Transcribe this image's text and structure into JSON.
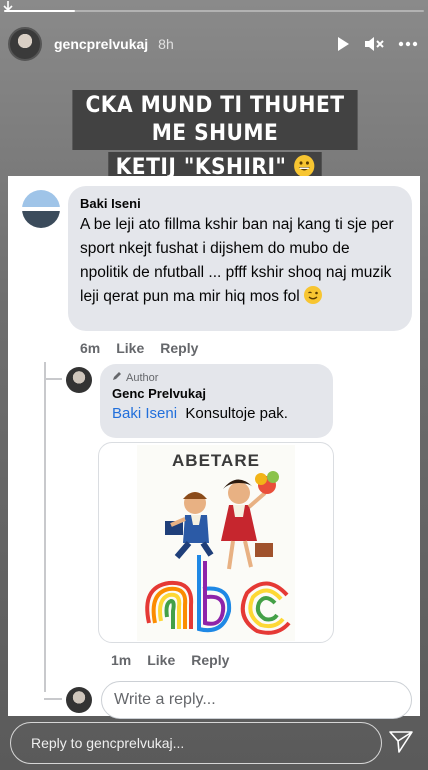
{
  "story": {
    "username": "gencprelvukaj",
    "time": "8h",
    "progress": 0.17
  },
  "caption": {
    "line1": "CKA MUND TI THUHET ME SHUME",
    "line2": "KETIJ \"KSHIRI\""
  },
  "comment": {
    "author": "Baki Iseni",
    "text": "A be leji ato fillma kshir ban naj kang ti sje per sport nkejt fushat i dijshem do mubo de npolitik de nfutball ... pfff kshir shoq naj muzik leji qerat pun ma mir hiq mos fol",
    "time": "6m",
    "like_label": "Like",
    "reply_label": "Reply"
  },
  "reply": {
    "badge": "Author",
    "author": "Genc Prelvukaj",
    "mention": "Baki Iseni",
    "text": "Konsultoje pak.",
    "image_title": "ABETARE",
    "time": "1m",
    "like_label": "Like",
    "reply_label": "Reply"
  },
  "write_reply": {
    "placeholder": "Write a reply..."
  },
  "footer": {
    "reply_placeholder": "Reply to gencprelvukaj..."
  }
}
